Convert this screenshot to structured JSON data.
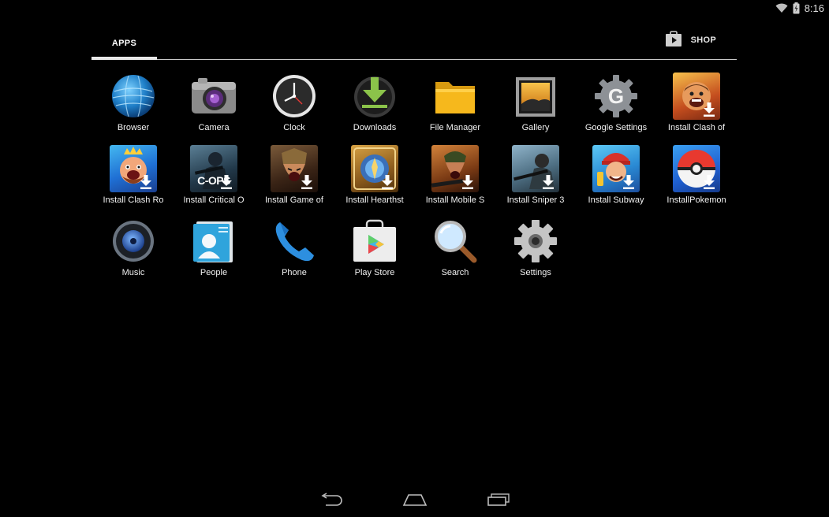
{
  "status": {
    "time": "8:16",
    "icons": [
      "wifi-icon",
      "battery-icon"
    ]
  },
  "tabs": {
    "apps_label": "APPS",
    "shop_label": "SHOP"
  },
  "apps": [
    {
      "label": "Browser",
      "icon": "browser-icon"
    },
    {
      "label": "Camera",
      "icon": "camera-icon"
    },
    {
      "label": "Clock",
      "icon": "clock-icon"
    },
    {
      "label": "Downloads",
      "icon": "downloads-icon"
    },
    {
      "label": "File Manager",
      "icon": "folder-icon"
    },
    {
      "label": "Gallery",
      "icon": "gallery-icon"
    },
    {
      "label": "Google Settings",
      "icon": "google-settings-icon"
    },
    {
      "label": "Install Clash of",
      "icon": "clash-of-clans-icon"
    },
    {
      "label": "Install Clash Ro",
      "icon": "clash-royale-icon"
    },
    {
      "label": "Install Critical O",
      "icon": "critical-ops-icon",
      "tile_text": "C-OPS"
    },
    {
      "label": "Install Game of",
      "icon": "game-of-war-icon"
    },
    {
      "label": "Install Hearthst",
      "icon": "hearthstone-icon"
    },
    {
      "label": "Install Mobile S",
      "icon": "mobile-strike-icon"
    },
    {
      "label": "Install Sniper 3",
      "icon": "sniper-3d-icon"
    },
    {
      "label": "Install Subway",
      "icon": "subway-surfers-icon"
    },
    {
      "label": "InstallPokemon",
      "icon": "pokemon-go-icon"
    },
    {
      "label": "Music",
      "icon": "music-icon"
    },
    {
      "label": "People",
      "icon": "people-icon"
    },
    {
      "label": "Phone",
      "icon": "phone-icon"
    },
    {
      "label": "Play Store",
      "icon": "play-store-icon"
    },
    {
      "label": "Search",
      "icon": "search-icon"
    },
    {
      "label": "Settings",
      "icon": "settings-icon"
    }
  ],
  "navbar": {
    "icons": [
      "back-icon",
      "home-icon",
      "recents-icon"
    ]
  }
}
